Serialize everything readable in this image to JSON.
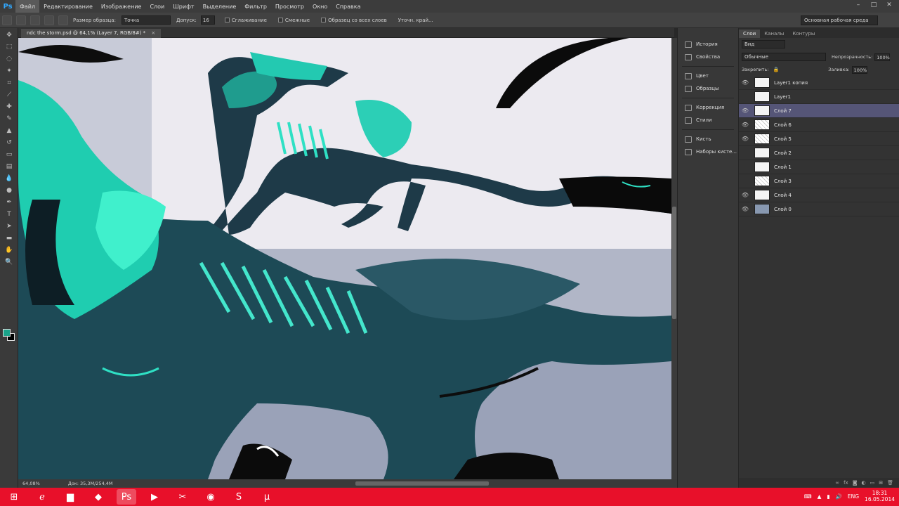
{
  "app": {
    "logo": "Ps"
  },
  "menu": [
    "Файл",
    "Редактирование",
    "Изображение",
    "Слои",
    "Шрифт",
    "Выделение",
    "Фильтр",
    "Просмотр",
    "Окно",
    "Справка"
  ],
  "window_controls": [
    "–",
    "□",
    "✕"
  ],
  "options": {
    "size_label": "Размер образца:",
    "size_value": "Точка",
    "tolerance_label": "Допуск:",
    "tolerance_value": "16",
    "antialias_label": "Сглаживание",
    "contiguous_label": "Смежные",
    "all_layers_label": "Образец со всех слоев",
    "refine_label": "Уточн. край...",
    "workspace": "Основная рабочая среда"
  },
  "document": {
    "tab_title": "ndc the storm.psd @ 64,1% (Layer 7, RGB/8#) *",
    "close": "×",
    "status_zoom": "64,08%",
    "status_doc": "Док: 35,3M/254,4M"
  },
  "dock_mid": {
    "items": [
      "История",
      "Свойства",
      "Цвет",
      "Образцы",
      "Коррекция",
      "Стили",
      "Кисть",
      "Наборы кисте..."
    ]
  },
  "layers_panel": {
    "tabs": [
      "Слои",
      "Каналы",
      "Контуры"
    ],
    "kind_value": "Вид",
    "blend_value": "Обычные",
    "opacity_label": "Непрозрачность:",
    "opacity_value": "100%",
    "lock_label": "Закрепить:",
    "fill_label": "Заливка:",
    "fill_value": "100%",
    "layers": [
      {
        "name": "Layer1 копия",
        "visible": true,
        "selected": false,
        "thumb": "white"
      },
      {
        "name": "Layer1",
        "visible": false,
        "selected": false,
        "thumb": "white"
      },
      {
        "name": "Слой 7",
        "visible": true,
        "selected": true,
        "thumb": "white"
      },
      {
        "name": "Слой 6",
        "visible": true,
        "selected": false,
        "thumb": "sketch"
      },
      {
        "name": "Слой 5",
        "visible": true,
        "selected": false,
        "thumb": "sketch"
      },
      {
        "name": "Слой 2",
        "visible": false,
        "selected": false,
        "thumb": "white"
      },
      {
        "name": "Слой 1",
        "visible": false,
        "selected": false,
        "thumb": "white"
      },
      {
        "name": "Слой 3",
        "visible": false,
        "selected": false,
        "thumb": "sketch"
      },
      {
        "name": "Слой 4",
        "visible": true,
        "selected": false,
        "thumb": "white"
      },
      {
        "name": "Слой 0",
        "visible": true,
        "selected": false,
        "thumb": "blue"
      }
    ]
  },
  "taskbar": {
    "lang": "ENG",
    "time": "18:31",
    "date": "16.05.2014"
  },
  "colors": {
    "taskbar": "#e8102a",
    "accent_teal": "#1aa38a",
    "selected_layer": "#555577"
  }
}
